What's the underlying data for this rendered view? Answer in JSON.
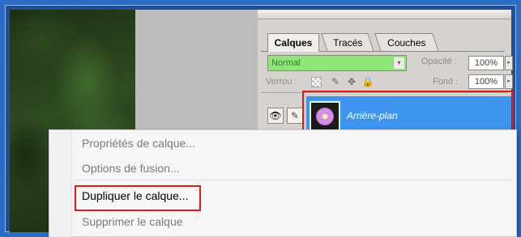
{
  "tabs": [
    {
      "label": "Calques",
      "active": true
    },
    {
      "label": "Tracés",
      "active": false
    },
    {
      "label": "Couches",
      "active": false
    }
  ],
  "blend_mode": {
    "value": "Normal",
    "arrow": "▾"
  },
  "opacity": {
    "label": "Opacité :",
    "value": "100%",
    "arrow": "▸"
  },
  "lock": {
    "label": "Verrou :",
    "icons": [
      "transparency-lock-icon",
      "brush-lock-icon",
      "move-lock-icon",
      "lock-icon"
    ]
  },
  "fill": {
    "label": "Fond :",
    "value": "100%",
    "arrow": "▸"
  },
  "layer": {
    "name": "Arrière-plan",
    "visible_icon": "👁",
    "brush_icon": "✎"
  },
  "context_menu": {
    "items": [
      {
        "label": "Propriétés de calque...",
        "enabled": false
      },
      {
        "label": "Options de fusion...",
        "enabled": false
      },
      {
        "label": "Dupliquer le calque...",
        "enabled": true
      },
      {
        "label": "Supprimer le calque",
        "enabled": false
      }
    ]
  },
  "colors": {
    "selected_layer": "#3d95f0",
    "blend_field": "#8ee67a",
    "highlight": "#e01818",
    "panel_bg": "#d6d3ce"
  }
}
